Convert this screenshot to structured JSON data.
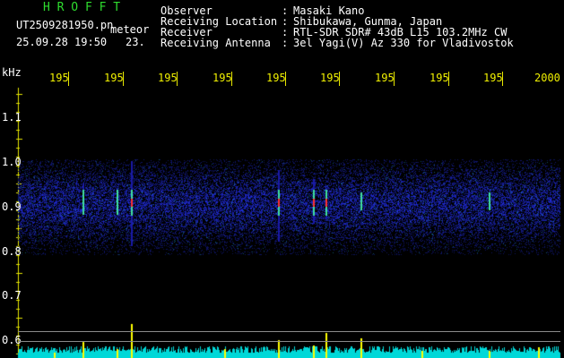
{
  "header": {
    "app_name": "H R O F F T",
    "filename": "UT2509281950.pn",
    "mode": "meteor",
    "datetime": "25.09.28 19:50",
    "count": "23.",
    "info_rows": [
      {
        "label": "Observer",
        "sep": ":",
        "value": "Masaki Kano"
      },
      {
        "label": "Receiving Location",
        "sep": ":",
        "value": "Shibukawa, Gunma, Japan"
      },
      {
        "label": "Receiver",
        "sep": ":",
        "value": "RTL-SDR SDR# 43dB L15 103.2MHz CW"
      },
      {
        "label": "Receiving Antenna",
        "sep": ":",
        "value": "3el Yagi(V) Az 330 for Vladivostok"
      }
    ]
  },
  "axes": {
    "y_unit": "kHz",
    "y_labels": [
      "1.1",
      "1.0",
      "0.9",
      "0.8",
      "0.7",
      "0.6"
    ],
    "x_labels": [
      "195",
      "195",
      "195",
      "195",
      "195",
      "195",
      "195",
      "195",
      "195",
      "2000"
    ]
  },
  "colors": {
    "background": "#000000",
    "text": "#ffffff",
    "title": "#2fdc2f",
    "axis": "#e6e600",
    "noise_base": "#1a1aa8",
    "signal_hot": "#ff3030",
    "signal_mid": "#40e0a0",
    "trace_base": "#00d8d8",
    "trace_peak": "#ffff00"
  }
}
